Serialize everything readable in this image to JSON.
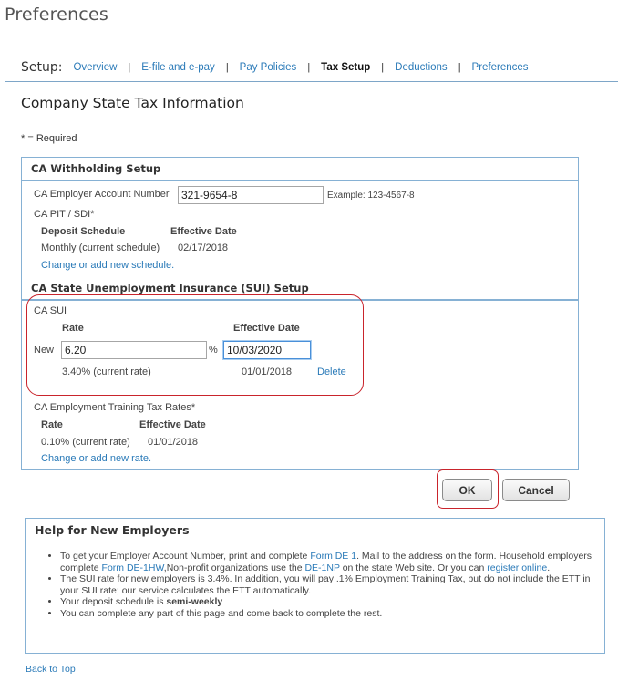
{
  "page_title": "Preferences",
  "setup": {
    "label": "Setup:",
    "tabs": [
      "Overview",
      "E-file and e-pay",
      "Pay Policies",
      "Tax Setup",
      "Deductions",
      "Preferences"
    ],
    "active_tab": "Tax Setup"
  },
  "section_title": "Company State Tax Information",
  "required_note": "* = Required",
  "withholding": {
    "header": "CA Withholding Setup",
    "employer_account_label": "CA Employer Account Number",
    "employer_account_value": "321-9654-8",
    "example": "Example: 123-4567-8",
    "pit_sdi_label": "CA PIT / SDI*",
    "col_deposit_schedule": "Deposit Schedule",
    "col_effective_date": "Effective Date",
    "schedule_value": "Monthly (current schedule)",
    "schedule_date": "02/17/2018",
    "change_schedule_link": "Change or add new schedule."
  },
  "sui": {
    "header": "CA State Unemployment Insurance (SUI) Setup",
    "label": "CA SUI",
    "col_rate": "Rate",
    "col_effective_date": "Effective Date",
    "new_label": "New",
    "new_rate_value": "6.20",
    "percent": "%",
    "new_date_value": "10/03/2020",
    "current_rate": "3.40% (current rate)",
    "current_date": "01/01/2018",
    "delete_link": "Delete"
  },
  "ett": {
    "label": "CA Employment Training Tax Rates*",
    "col_rate": "Rate",
    "col_effective_date": "Effective Date",
    "rate_value": "0.10% (current rate)",
    "rate_date": "01/01/2018",
    "change_rate_link": "Change or add new rate."
  },
  "buttons": {
    "ok": "OK",
    "cancel": "Cancel"
  },
  "help": {
    "header": "Help for New Employers",
    "bullet1": {
      "t1": "To get your Employer Account Number, print and complete ",
      "link1": "Form DE 1",
      "t2": ". Mail to the address on the form. Household employers complete ",
      "link2": "Form DE-1HW",
      "t3": ",Non-profit organizations use the ",
      "link3": "DE-1NP",
      "t4": " on the state Web site. Or you can ",
      "link4": "register online",
      "t5": "."
    },
    "bullet2": "The SUI rate for new employers is 3.4%. In addition, you will pay .1% Employment Training Tax, but do not include the ETT in your SUI rate; our service calculates the ETT automatically.",
    "bullet3_prefix": "Your deposit schedule is ",
    "bullet3_bold": "semi-weekly",
    "bullet4": "You can complete any part of this page and come back to complete the rest."
  },
  "back_to_top": "Back to Top",
  "colors": {
    "link": "#2a7ab8",
    "panel_border": "#86b1d4",
    "highlight": "#c9242c"
  }
}
